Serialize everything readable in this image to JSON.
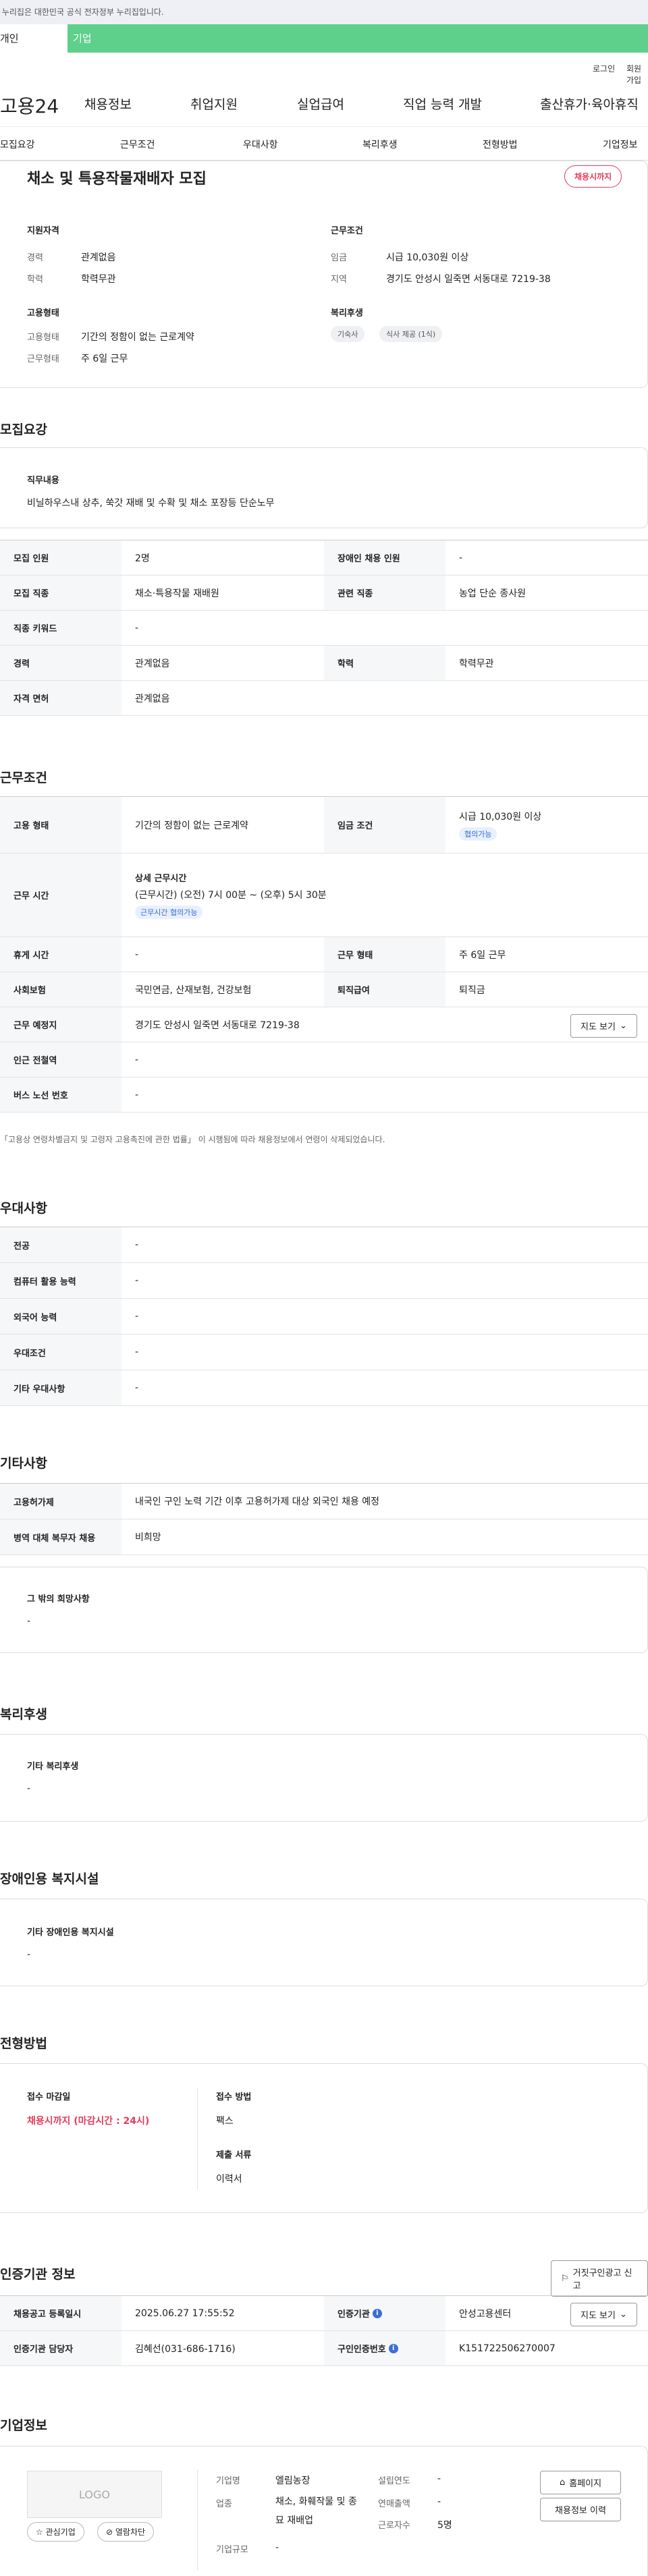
{
  "gov_bar": "이 누리집은 대한민국 공식 전자정부 누리집입니다.",
  "user_tabs": [
    "개인",
    "기업"
  ],
  "util": {
    "login": "로그인",
    "join": "회원가입"
  },
  "gnb": {
    "logo": "고용24",
    "menu": [
      "채용정보",
      "취업지원",
      "실업급여",
      "직업 능력 개발",
      "출산휴가·육아휴직"
    ]
  },
  "subnav": [
    "모집요강",
    "근무조건",
    "우대사항",
    "복리후생",
    "전형방법",
    "기업정보"
  ],
  "summary": {
    "title": "채소 및 특용작물재배자 모집",
    "badge": "채용시까지",
    "qual_title": "지원자격",
    "qual": [
      {
        "k": "경력",
        "v": "관계없음"
      },
      {
        "k": "학력",
        "v": "학력무관"
      }
    ],
    "cond_title": "근무조건",
    "cond": [
      {
        "k": "임금",
        "v": "시급 10,030원 이상"
      },
      {
        "k": "지역",
        "v": "경기도 안성시 일죽면 서동대로 7219-38"
      }
    ],
    "emp_title": "고용형태",
    "emp": [
      {
        "k": "고용형태",
        "v": "기간의 정함이 없는 근로계약"
      },
      {
        "k": "근무형태",
        "v": "주 6일 근무"
      }
    ],
    "welfare_title": "복리후생",
    "welfare_tags": [
      "기숙사",
      "식사 제공 (1식)"
    ]
  },
  "recruit": {
    "heading": "모집요강",
    "duty_title": "직무내용",
    "duty": "비닐하우스내 상추, 쑥갓 재배 및 수확 및 채소 포장등 단순노무",
    "rows": [
      {
        "k1": "모집 인원",
        "v1": "2명",
        "k2": "장애인 채용 인원",
        "v2": "-"
      },
      {
        "k1": "모집 직종",
        "v1": "채소·특용작물 재배원",
        "k2": "관련 직종",
        "v2": "농업 단순 종사원"
      },
      {
        "k1": "직종 키워드",
        "v1": "-"
      },
      {
        "k1": "경력",
        "v1": "관계없음",
        "k2": "학력",
        "v2": "학력무관"
      },
      {
        "k1": "자격 면허",
        "v1": "관계없음"
      }
    ]
  },
  "work": {
    "heading": "근무조건",
    "emp_type_k": "고용 형태",
    "emp_type_v": "기간의 정함이 없는 근로계약",
    "wage_k": "임금 조건",
    "wage_v": "시급 10,030원 이상",
    "wage_chip": "협의가능",
    "time_k": "근무 시간",
    "time_title": "상세 근무시간",
    "time_v": "(근무시간) (오전) 7시 00분 ~ (오후) 5시 30분",
    "time_chip": "근무시간 협의가능",
    "rest_k": "휴게 시간",
    "rest_v": "-",
    "form_k": "근무 형태",
    "form_v": "주 6일 근무",
    "ins_k": "사회보험",
    "ins_v": "국민연금, 산재보험, 건강보험",
    "sev_k": "퇴직급여",
    "sev_v": "퇴직금",
    "place_k": "근무 예정지",
    "place_v": "경기도 안성시 일죽면 서동대로 7219-38",
    "map_btn": "지도 보기",
    "sub_k": "인근 전철역",
    "sub_v": "-",
    "bus_k": "버스 노선 번호",
    "bus_v": "-",
    "note": "「고용상 연령차별금지 및 고령자 고용촉진에 관한 법률」 이 시행됨에 따라 채용정보에서 연령이 삭제되었습니다."
  },
  "pref": {
    "heading": "우대사항",
    "rows": [
      {
        "k": "전공",
        "v": "-"
      },
      {
        "k": "컴퓨터 활용 능력",
        "v": "-"
      },
      {
        "k": "외국어 능력",
        "v": "-"
      },
      {
        "k": "우대조건",
        "v": "-"
      },
      {
        "k": "기타 우대사항",
        "v": "-"
      }
    ]
  },
  "etc": {
    "heading": "기타사항",
    "rows": [
      {
        "k": "고용허가제",
        "v": "내국인 구인 노력 기간 이후 고용허가제 대상 외국인 채용 예정"
      },
      {
        "k": "병역 대체 복무자 채용",
        "v": "비희망"
      }
    ],
    "other_title": "그 밖의 희망사항",
    "other_v": "-"
  },
  "benefit": {
    "heading": "복리후생",
    "title": "기타 복리후생",
    "v": "-"
  },
  "disab": {
    "heading": "장애인용 복지시설",
    "title": "기타 장애인용 복지시설",
    "v": "-"
  },
  "process": {
    "heading": "전형방법",
    "deadline_title": "접수 마감일",
    "deadline_v": "채용시까지 (마감시간 : 24시)",
    "method_title": "접수 방법",
    "method_v": "팩스",
    "docs_title": "제출 서류",
    "docs_v": "이력서"
  },
  "cert": {
    "heading": "인증기관 정보",
    "report_btn": "거짓구인광고 신고",
    "reg_k": "채용공고 등록일시",
    "reg_v": "2025.06.27 17:55:52",
    "org_k": "인증기관",
    "org_v": "안성고용센터",
    "map_btn": "지도 보기",
    "mgr_k": "인증기관 담당자",
    "mgr_v": "김혜선(031-686-1716)",
    "no_k": "구인인증번호",
    "no_v": "K151722506270007"
  },
  "company": {
    "heading": "기업정보",
    "logo": "LOGO",
    "fav_btn": "관심기업",
    "block_btn": "열람차단",
    "name_k": "기업명",
    "name_v": "엘림농장",
    "industry_k": "업종",
    "industry_v": "채소, 화훼작물 및 종묘 재배업",
    "scale_k": "기업규모",
    "scale_v": "-",
    "founded_k": "설립연도",
    "founded_v": "-",
    "sales_k": "연매출액",
    "sales_v": "-",
    "emp_k": "근로자수",
    "emp_v": "5명",
    "home_btn": "홈페이지",
    "list_btn": "채용정보 이력"
  }
}
